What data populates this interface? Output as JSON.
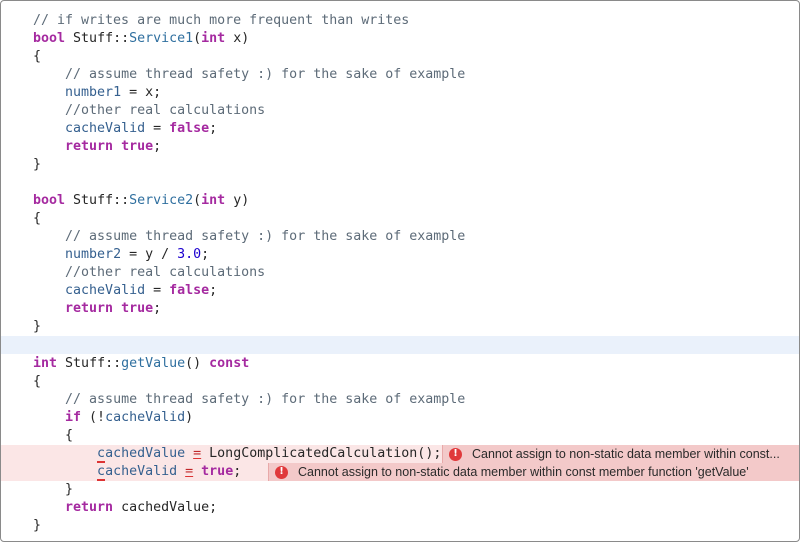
{
  "lines": {
    "l1": {
      "comment": "// if writes are much more frequent than writes"
    },
    "l2": {
      "kw": "bool",
      "cls": "Stuff",
      "sep": "::",
      "fn": "Service1",
      "open": "(",
      "ptype": "int",
      "param": " x",
      "close": ")"
    },
    "l3": {
      "text": "{"
    },
    "l4": {
      "comment": "// assume thread safety :) for the sake of example"
    },
    "l5": {
      "mem": "number1",
      "rest": " = x;"
    },
    "l6": {
      "comment": "//other real calculations"
    },
    "l7": {
      "mem": "cacheValid",
      "eq": " = ",
      "val": "false",
      "semi": ";"
    },
    "l8": {
      "kw": "return",
      "val": "true",
      "semi": ";"
    },
    "l9": {
      "text": "}"
    },
    "l11": {
      "kw": "bool",
      "cls": "Stuff",
      "sep": "::",
      "fn": "Service2",
      "open": "(",
      "ptype": "int",
      "param": " y",
      "close": ")"
    },
    "l12": {
      "text": "{"
    },
    "l13": {
      "comment": "// assume thread safety :) for the sake of example"
    },
    "l14": {
      "mem": "number2",
      "pre": " = y / ",
      "num": "3.0",
      "semi": ";"
    },
    "l15": {
      "comment": "//other real calculations"
    },
    "l16": {
      "mem": "cacheValid",
      "eq": " = ",
      "val": "false",
      "semi": ";"
    },
    "l17": {
      "kw": "return",
      "val": "true",
      "semi": ";"
    },
    "l18": {
      "text": "}"
    },
    "l20": {
      "kw": "int",
      "cls": "Stuff",
      "sep": "::",
      "fn": "getValue",
      "parens": "()",
      "kw2": "const"
    },
    "l21": {
      "text": "{"
    },
    "l22": {
      "comment": "// assume thread safety :) for the sake of example"
    },
    "l23": {
      "kw": "if",
      "open": " (!",
      "mem": "cacheValid",
      "close": ")"
    },
    "l24": {
      "text": "{"
    },
    "l25": {
      "mem_first": "c",
      "mem_rest": "achedValue",
      "eq": "=",
      "call": "LongComplicatedCalculation();"
    },
    "l26": {
      "mem_first": "c",
      "mem_rest": "acheValid",
      "eq": "=",
      "val": "true",
      "semi": ";"
    },
    "l27": {
      "text": "}"
    },
    "l28": {
      "kw": "return",
      "rest": " cachedValue;"
    },
    "l29": {
      "text": "}"
    }
  },
  "diagnostics": [
    {
      "icon": "!",
      "message": "Cannot assign to non-static data member within const..."
    },
    {
      "icon": "!",
      "message": "Cannot assign to non-static data member within const member function 'getValue'"
    }
  ]
}
